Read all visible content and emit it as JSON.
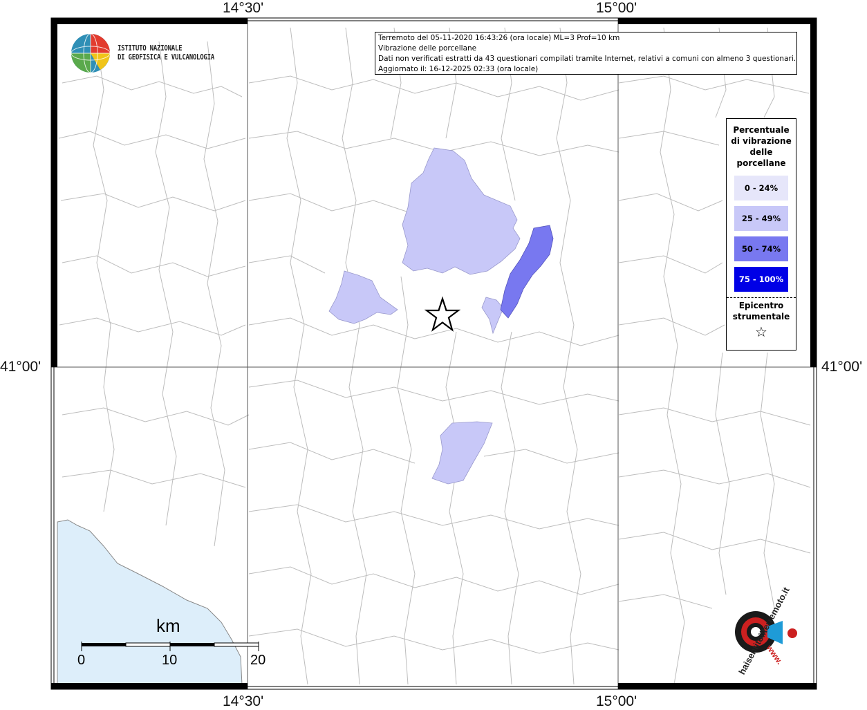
{
  "institute": {
    "line1": "ISTITUTO NAZIONALE",
    "line2": "DI GEOFISICA E VULCANOLOGIA"
  },
  "title_box": {
    "line1": "Terremoto del 05-11-2020 16:43:26 (ora locale) ML=3 Prof=10 km",
    "line2": "Vibrazione delle porcellane",
    "line3": "Dati non verificati estratti da 43 questionari compilati tramite Internet, relativi a comuni con almeno 3 questionari.",
    "line4": "Aggiornato il: 16-12-2025 02:33 (ora locale)"
  },
  "coordinates": {
    "lon_left": "14°30'",
    "lon_right": "15°00'",
    "lat_mid": "41°00'"
  },
  "legend": {
    "title_lines": [
      "Percentuale",
      "di vibrazione",
      "delle",
      "porcellane"
    ],
    "classes": [
      {
        "label": "0 - 24%",
        "color": "#e6e6fa",
        "text_color": "#000000"
      },
      {
        "label": "25 - 49%",
        "color": "#c8c8f8",
        "text_color": "#000000"
      },
      {
        "label": "50 - 74%",
        "color": "#7878f0",
        "text_color": "#000000"
      },
      {
        "label": "75 - 100%",
        "color": "#0000e6",
        "text_color": "#ffffff"
      }
    ],
    "epicenter_lines": [
      "Epicentro",
      "strumentale"
    ],
    "epicenter_symbol": "☆"
  },
  "scale_bar": {
    "unit": "km",
    "ticks": [
      "0",
      "10",
      "20"
    ]
  },
  "brand": {
    "text": "haisentitoilterremoto.it",
    "www": "www."
  },
  "colors": {
    "sea": "#ddeefa",
    "boundary": "#b8b8b8",
    "grid": "#555555"
  }
}
